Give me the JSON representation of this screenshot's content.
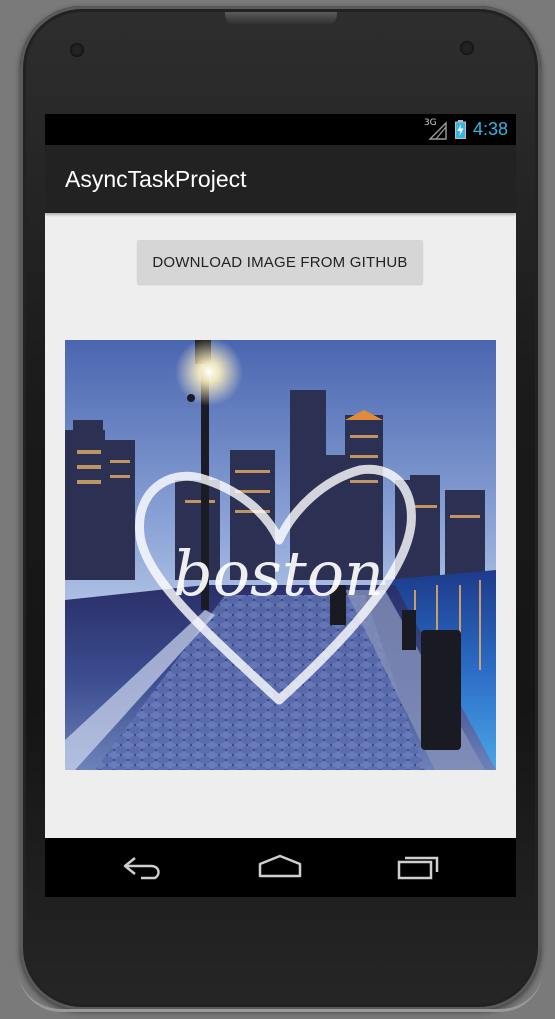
{
  "status_bar": {
    "network_label": "3G",
    "time": "4:38",
    "icons": [
      "signal-icon",
      "battery-charging-icon"
    ],
    "clock_color": "#33b5e5"
  },
  "action_bar": {
    "title": "AsyncTaskProject",
    "background": "#222222"
  },
  "main": {
    "download_button_label": "DOWNLOAD IMAGE FROM GITHUB",
    "image": {
      "description_icon": "boston-skyline-heart-image",
      "overlay_text": "boston"
    }
  },
  "nav_bar": {
    "buttons": [
      "back-icon",
      "home-icon",
      "recent-apps-icon"
    ]
  }
}
